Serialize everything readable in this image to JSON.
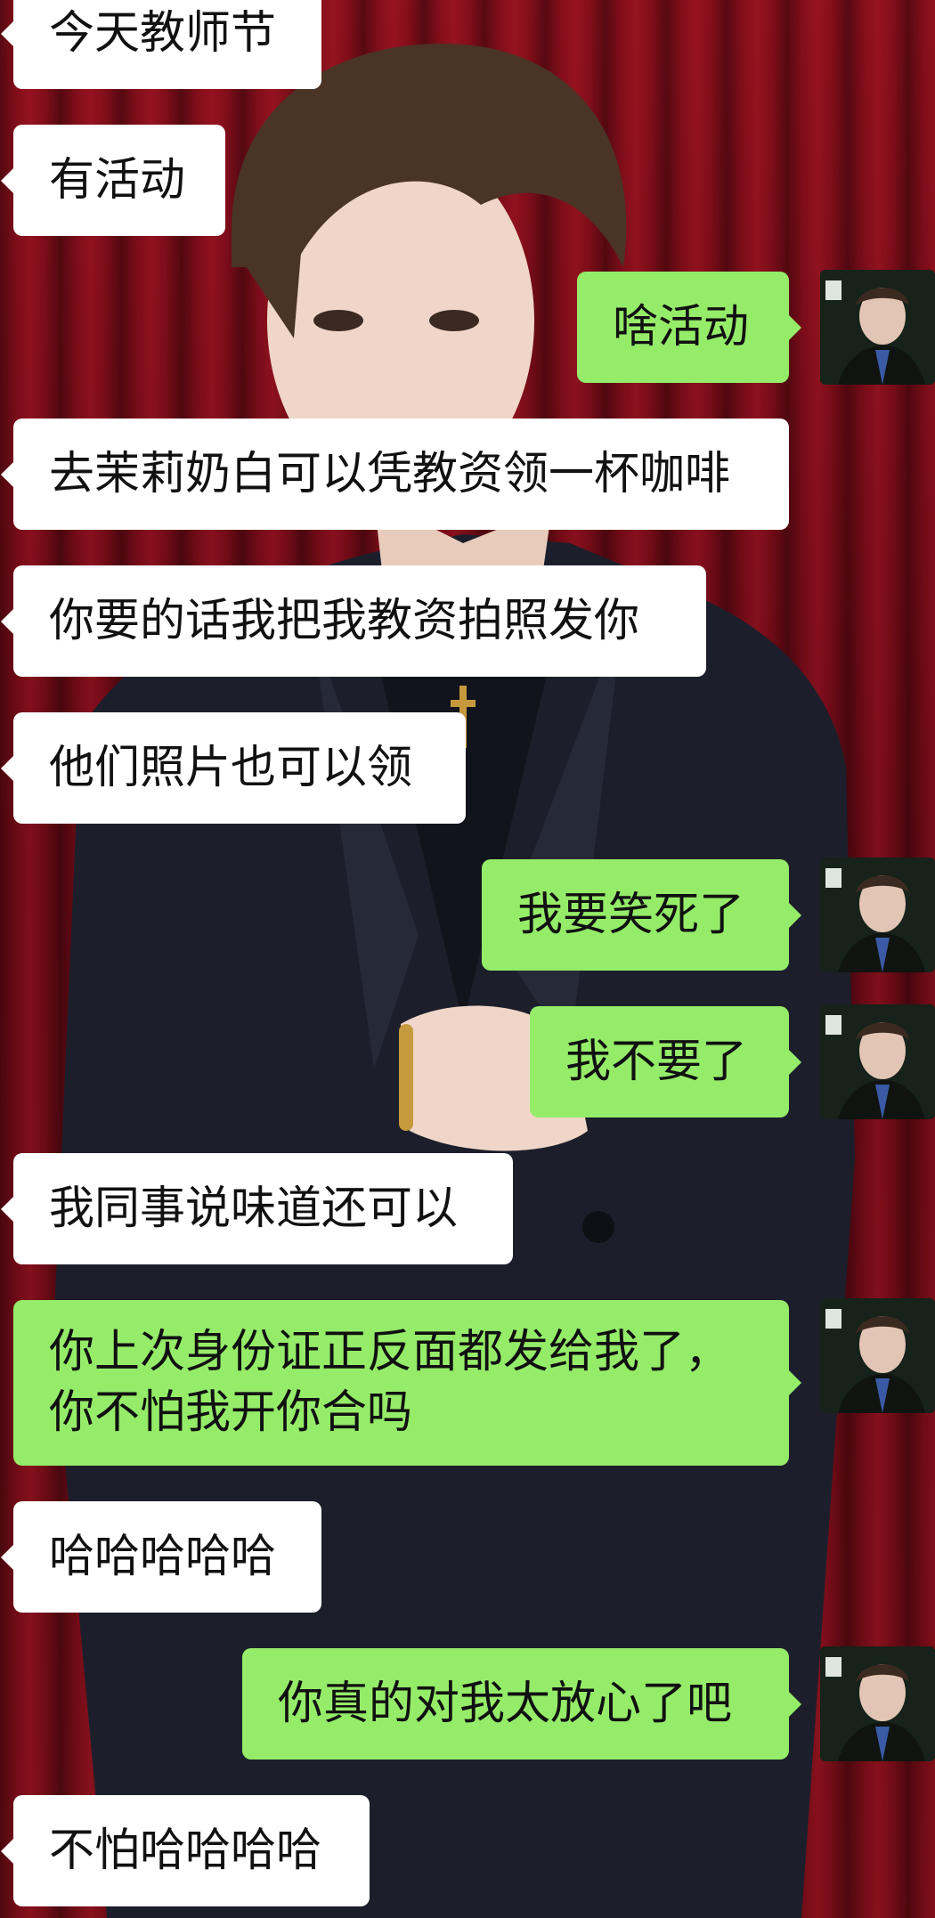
{
  "messages": [
    {
      "side": "in",
      "text": "今天教师节"
    },
    {
      "side": "in",
      "text": "有活动"
    },
    {
      "side": "out",
      "text": "啥活动"
    },
    {
      "side": "in",
      "text": "去茉莉奶白可以凭教资领一杯咖啡"
    },
    {
      "side": "in",
      "text": "你要的话我把我教资拍照发你"
    },
    {
      "side": "in",
      "text": "他们照片也可以领"
    },
    {
      "side": "out",
      "text": "我要笑死了"
    },
    {
      "side": "out",
      "text": "我不要了"
    },
    {
      "side": "in",
      "text": "我同事说味道还可以"
    },
    {
      "side": "out",
      "text": "你上次身份证正反面都发给我了，\n你不怕我开你合吗"
    },
    {
      "side": "in",
      "text": "哈哈哈哈哈"
    },
    {
      "side": "out",
      "text": "你真的对我太放心了吧"
    },
    {
      "side": "in",
      "text": "不怕哈哈哈哈"
    }
  ],
  "colors": {
    "incoming_bubble": "#ffffff",
    "outgoing_bubble": "#95ec69",
    "text": "#111111",
    "wallpaper_curtain": "#8c0f1c"
  },
  "icons": {
    "self_avatar": "person-photo-avatar"
  }
}
